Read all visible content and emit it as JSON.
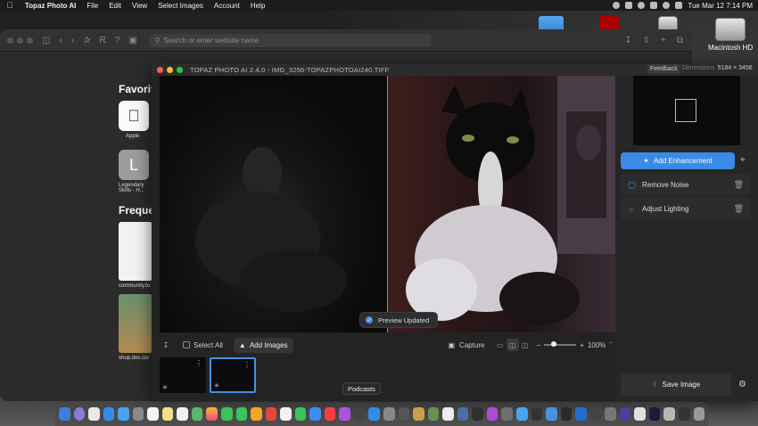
{
  "menubar": {
    "app_name": "Topaz Photo AI",
    "items": [
      "File",
      "Edit",
      "View",
      "Select Images",
      "Account",
      "Help"
    ],
    "datetime": "Tue Mar 12  7:14 PM"
  },
  "desktop": {
    "disk_label": "Macintosh HD"
  },
  "safari": {
    "url_placeholder": "Search or enter website name",
    "favorites_heading": "Favorit",
    "tile_apple_label": "Apple",
    "tile_l_letter": "L",
    "tile_l_label": "Legendary Skills - H...",
    "frequent_heading": "Freque",
    "frequent_1_label": "community.to",
    "frequent_2_label": "shop.dxo.cor"
  },
  "topaz": {
    "title": "TOPAZ PHOTO AI 2.4.0 - IMG_3256-TOPAZPHOTOAI240.TIFF",
    "feedback_label": "Feedback",
    "dimensions_label": "Dimensions",
    "dimensions_value": "5184 × 3456",
    "preview_toast": "Preview Updated",
    "toolbar": {
      "select_all_label": "Select All",
      "add_images_label": "Add Images",
      "capture_label": "Capture",
      "zoom_value": "100%"
    },
    "panel": {
      "add_enhancement_label": "Add Enhancement",
      "filters": [
        {
          "name": "Remove Noise"
        },
        {
          "name": "Adjust Lighting"
        }
      ],
      "save_label": "Save Image"
    }
  },
  "dock": {
    "tooltip": "Podcasts"
  },
  "colors": {
    "accent": "#3b8be6",
    "panel_bg": "#262626",
    "window_bg": "#232323"
  }
}
